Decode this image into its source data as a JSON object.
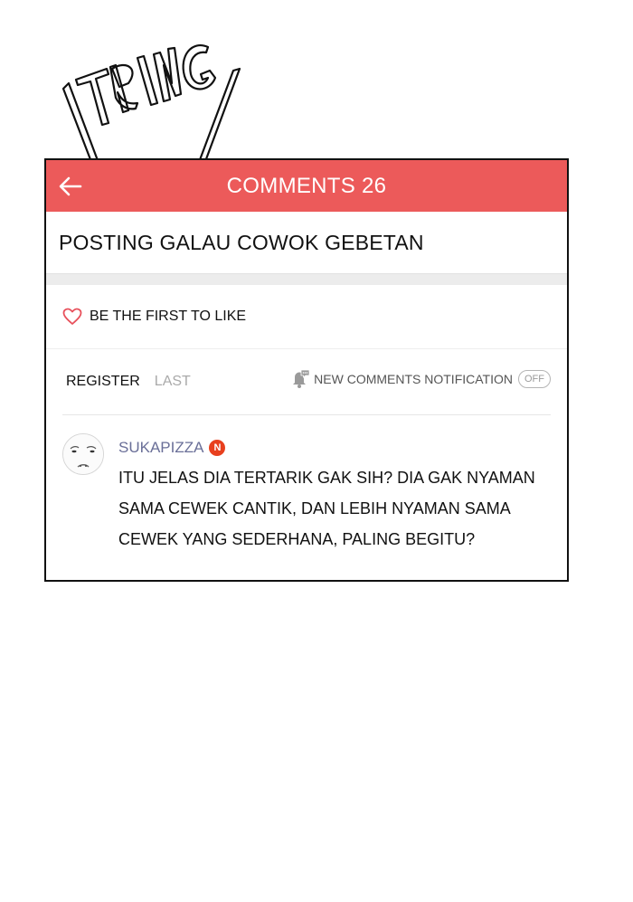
{
  "sfx": {
    "text": "TRING"
  },
  "header": {
    "title": "COMMENTS 26",
    "back_icon": "arrow-left-icon",
    "color": "#ec5a5a"
  },
  "post": {
    "title": "POSTING GALAU COWOK GEBETAN"
  },
  "like": {
    "icon": "heart-outline-icon",
    "text": "BE THE FIRST TO LIKE"
  },
  "tabs": [
    {
      "label": "REGISTER",
      "active": true
    },
    {
      "label": "LAST",
      "active": false
    }
  ],
  "notification": {
    "icon": "bell-chat-icon",
    "label": "NEW COMMENTS NOTIFICATION",
    "toggle_label": "OFF"
  },
  "comments": [
    {
      "username": "SUKAPIZZA",
      "badge": "N",
      "text": "ITU JELAS DIA TERTARIK GAK SIH? DIA GAK NYAMAN SAMA CEWEK CANTIK, DAN LEBIH NYAMAN SAMA CEWEK YANG SEDERHANA, PALING BEGITU?"
    }
  ]
}
